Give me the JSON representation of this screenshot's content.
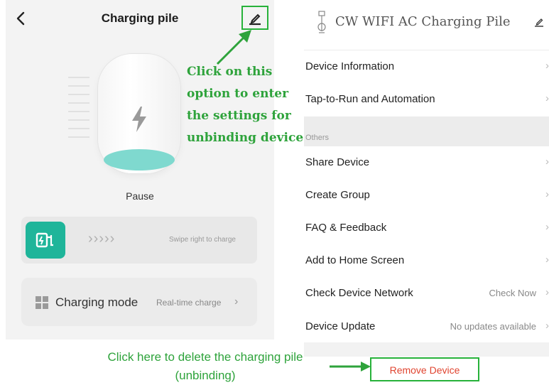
{
  "left": {
    "title": "Charging pile",
    "status": "Pause",
    "swipe_hint": "Swipe right to charge",
    "swipe_chevrons": "›››››",
    "mode_label": "Charging mode",
    "mode_value": "Real-time charge",
    "mode_arrow": "›"
  },
  "annotations": {
    "edit_lines": [
      "Click on this",
      "option to enter",
      "the settings for",
      "unbinding device"
    ],
    "remove_lines": [
      "Click here to delete the charging pile",
      "(unbinding)"
    ]
  },
  "right": {
    "title": "CW WIFI AC Charging Pile",
    "section_label": "Others",
    "rows_top": [
      {
        "label": "Device Information",
        "value": ""
      },
      {
        "label": "Tap-to-Run and Automation",
        "value": ""
      }
    ],
    "rows_others": [
      {
        "label": "Share Device",
        "value": ""
      },
      {
        "label": "Create Group",
        "value": ""
      },
      {
        "label": "FAQ & Feedback",
        "value": ""
      },
      {
        "label": "Add to Home Screen",
        "value": ""
      },
      {
        "label": "Check Device Network",
        "value": "Check Now"
      },
      {
        "label": "Device Update",
        "value": "No updates available"
      }
    ],
    "arrow": "›",
    "remove_label": "Remove Device"
  },
  "colors": {
    "accent_green": "#27b23a",
    "teal": "#1fb59a",
    "remove_red": "#e0442f"
  },
  "icons": [
    "back-icon",
    "edit-icon",
    "lightning-icon",
    "charge-plug-icon",
    "grid-icon",
    "pile-logo-icon"
  ]
}
